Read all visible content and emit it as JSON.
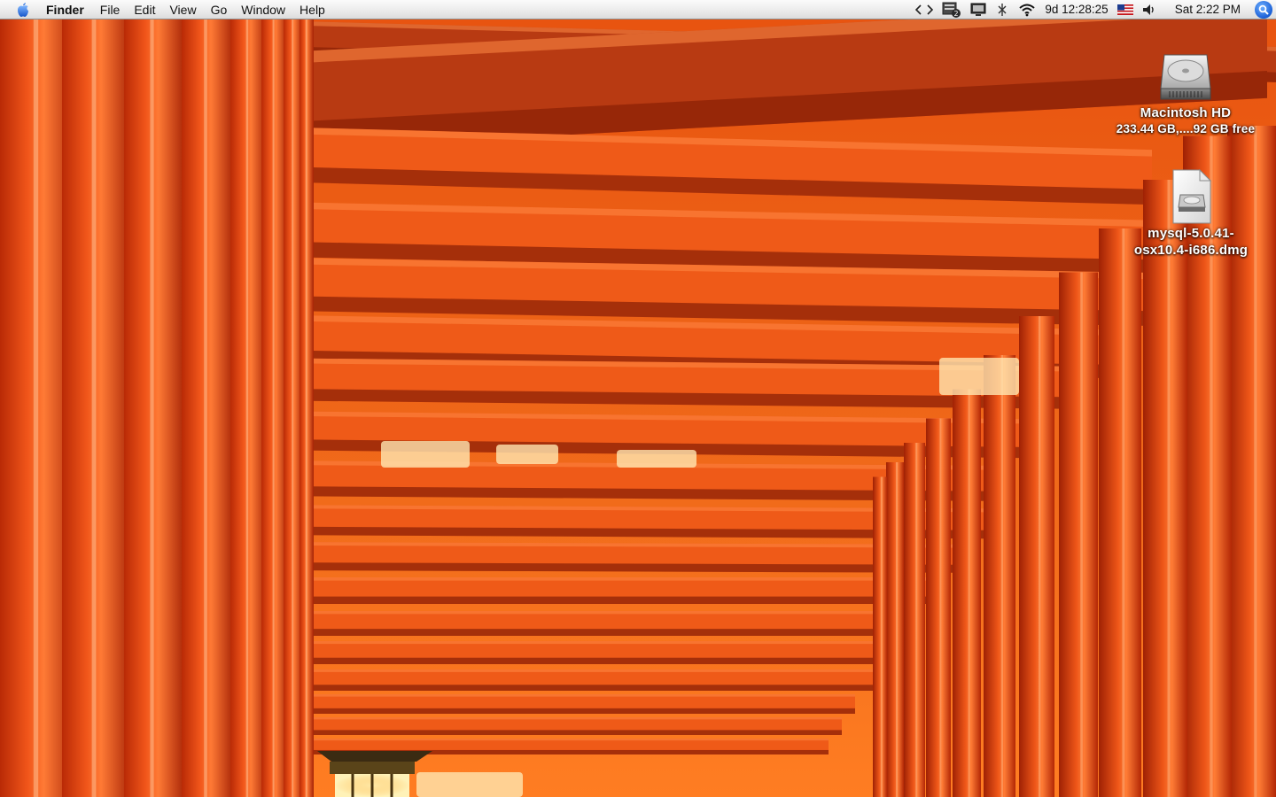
{
  "menubar": {
    "icons": {
      "apple": "apple-logo-icon",
      "scripts": "code-brackets-icon",
      "badge": "document-badge-icon",
      "display": "display-icon",
      "bluetooth": "bluetooth-icon",
      "wifi": "wifi-icon",
      "flag": "us-flag-icon",
      "volume": "speaker-volume-icon",
      "spotlight": "spotlight-search-icon"
    },
    "app_name": "Finder",
    "menus": [
      "File",
      "Edit",
      "View",
      "Go",
      "Window",
      "Help"
    ],
    "badge_count": "2",
    "uptime": "9d 12:28:25",
    "clock": "Sat 2:22 PM"
  },
  "desktop": {
    "icons": [
      {
        "label": "Macintosh HD",
        "sublabel": "233.44 GB,....92 GB free",
        "icon": "hard-drive-icon"
      },
      {
        "label_line1": "mysql-5.0.41-",
        "label_line2": "osx10.4-i686.dmg",
        "icon": "disk-image-icon"
      }
    ]
  },
  "colors": {
    "menubar_bg": "#ececec",
    "spotlight_blue": "#1a5fd6",
    "wallpaper_red": "#d9420a",
    "beam_orange": "#ff6a1f",
    "beam_shadow": "#7a1c06"
  }
}
